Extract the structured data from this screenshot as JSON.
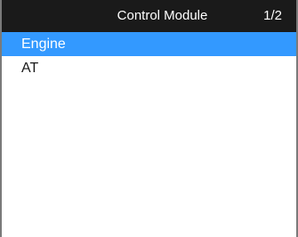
{
  "header": {
    "title": "Control Module",
    "page_indicator": "1/2"
  },
  "list": {
    "items": [
      {
        "label": "Engine",
        "selected": true
      },
      {
        "label": "AT",
        "selected": false
      }
    ]
  },
  "colors": {
    "header_background": "#1a1a1a",
    "selection_highlight": "#3399ff",
    "border": "#7a7a7a"
  }
}
